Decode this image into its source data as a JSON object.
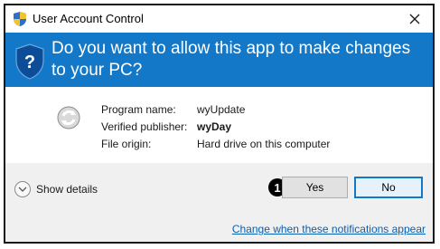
{
  "window": {
    "title": "User Account Control",
    "close_icon": "close-icon"
  },
  "banner": {
    "question": "Do you want to allow this app to make changes to your PC?",
    "icon": "shield-question-icon",
    "color": "#1478c8"
  },
  "program": {
    "icon": "program-refresh-icon",
    "name_label": "Program name:",
    "name_value": "wyUpdate",
    "publisher_label": "Verified publisher:",
    "publisher_value": "wyDay",
    "origin_label": "File origin:",
    "origin_value": "Hard drive on this computer"
  },
  "footer": {
    "details_label": "Show details",
    "details_icon": "chevron-down-icon",
    "step_marker": "1",
    "yes_label": "Yes",
    "no_label": "No",
    "notifications_link": "Change when these notifications appear"
  }
}
